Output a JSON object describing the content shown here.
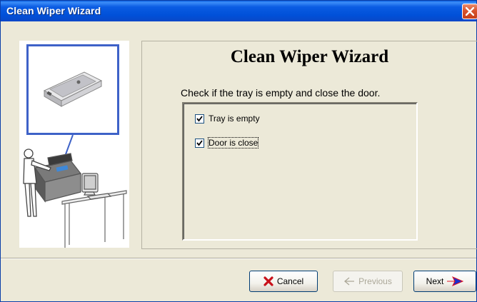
{
  "window": {
    "title": "Clean Wiper Wizard",
    "close_icon": "close-icon"
  },
  "wizard": {
    "heading": "Clean Wiper Wizard",
    "instruction": "Check if the tray is empty and close the door.",
    "checkboxes": [
      {
        "label": "Tray is empty",
        "checked": true
      },
      {
        "label": "Door is close",
        "checked": true
      }
    ]
  },
  "buttons": {
    "cancel": {
      "label": "Cancel",
      "icon": "red-x-icon"
    },
    "previous": {
      "label": "Previous",
      "icon": "back-arrow-icon",
      "enabled": false
    },
    "next": {
      "label": "Next",
      "icon": "forward-arrow-icon"
    }
  },
  "colors": {
    "titlebar": "#0054e3",
    "close": "#d9532c",
    "frame": "#3e62c8",
    "dialog": "#ece9d8"
  }
}
